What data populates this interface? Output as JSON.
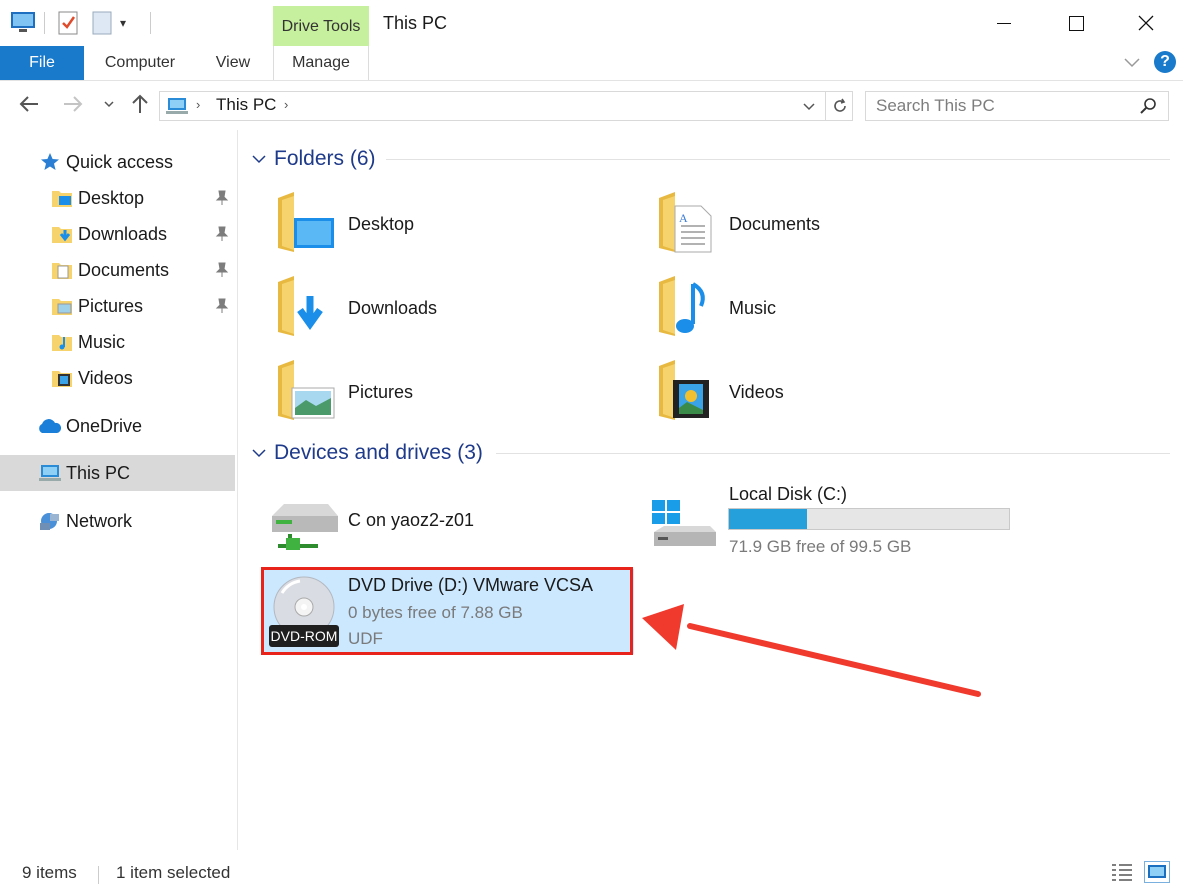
{
  "window": {
    "title": "This PC"
  },
  "ribbon": {
    "contextual_group": "Drive Tools",
    "tabs": [
      "File",
      "Computer",
      "View",
      "Manage"
    ]
  },
  "address": {
    "crumb": "This PC",
    "search_placeholder": "Search This PC"
  },
  "nav": {
    "quick_access": "Quick access",
    "pinned": [
      "Desktop",
      "Downloads",
      "Documents",
      "Pictures"
    ],
    "unpinned": [
      "Music",
      "Videos"
    ],
    "onedrive": "OneDrive",
    "this_pc": "This PC",
    "network": "Network"
  },
  "folders": {
    "title": "Folders (6)",
    "items": [
      "Desktop",
      "Documents",
      "Downloads",
      "Music",
      "Pictures",
      "Videos"
    ]
  },
  "drives": {
    "title": "Devices and drives (3)",
    "network_drive": "C on yaoz2-z01",
    "local_disk": {
      "name": "Local Disk (C:)",
      "free": "71.9 GB free of 99.5 GB",
      "used_fraction": 0.277
    },
    "dvd": {
      "name": "DVD Drive (D:) VMware VCSA",
      "free": "0 bytes free of 7.88 GB",
      "fs": "UDF",
      "badge": "DVD-ROM"
    }
  },
  "status": {
    "count": "9 items",
    "selected": "1 item selected"
  },
  "colors": {
    "accent": "#1979ca",
    "selection": "#cce8ff",
    "highlight_box": "#e8231b",
    "arrow": "#f03a2e",
    "drive_tools": "#c6ef9e",
    "bar": "#26a0da"
  }
}
